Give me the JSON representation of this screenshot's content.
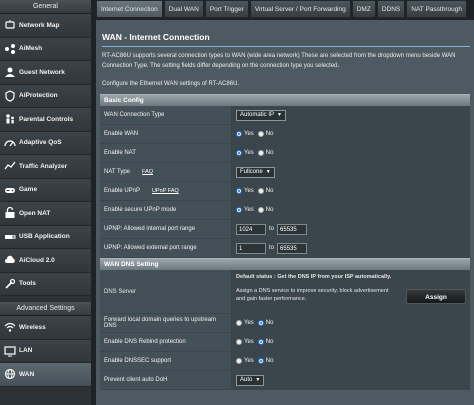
{
  "sidebar": {
    "general_title": "General",
    "items": [
      {
        "label": "Network Map",
        "icon": "network-map-icon"
      },
      {
        "label": "AiMesh",
        "icon": "aimesh-icon"
      },
      {
        "label": "Guest Network",
        "icon": "guest-network-icon"
      },
      {
        "label": "AiProtection",
        "icon": "shield-icon"
      },
      {
        "label": "Parental Controls",
        "icon": "parental-controls-icon"
      },
      {
        "label": "Adaptive QoS",
        "icon": "qos-icon"
      },
      {
        "label": "Traffic Analyzer",
        "icon": "traffic-analyzer-icon"
      },
      {
        "label": "Game",
        "icon": "gamepad-icon"
      },
      {
        "label": "Open NAT",
        "icon": "open-nat-icon"
      },
      {
        "label": "USB Application",
        "icon": "usb-icon"
      },
      {
        "label": "AiCloud 2.0",
        "icon": "cloud-icon"
      },
      {
        "label": "Tools",
        "icon": "tools-icon"
      }
    ],
    "advanced_title": "Advanced Settings",
    "advanced_items": [
      {
        "label": "Wireless",
        "icon": "wireless-icon"
      },
      {
        "label": "LAN",
        "icon": "lan-icon"
      },
      {
        "label": "WAN",
        "icon": "globe-icon"
      }
    ]
  },
  "tabs": [
    "Internet Connection",
    "Dual WAN",
    "Port Trigger",
    "Virtual Server / Port Forwarding",
    "DMZ",
    "DDNS",
    "NAT Passthrough"
  ],
  "page": {
    "title": "WAN - Internet Connection",
    "description": "RT-AC86U supports several connection types to WAN (wide area network) These are selected from the dropdown menu beside WAN Connection Type. The setting fields differ depending on the connection type you selected.",
    "configure": "Configure the Ethernet WAN settings of RT-AC86U."
  },
  "basic": {
    "title": "Basic Config",
    "conn_type_label": "WAN Connection Type",
    "conn_type_value": "Automatic IP",
    "enable_wan_label": "Enable WAN",
    "enable_nat_label": "Enable NAT",
    "nat_type_label": "NAT Type",
    "nat_type_faq": "FAQ",
    "nat_type_value": "Fullcone",
    "upnp_label": "Enable UPnP",
    "upnp_faq": "UPnP FAQ",
    "secure_upnp_label": "Enable secure UPnP mode",
    "internal_range_label": "UPNP: Allowed internal port range",
    "internal_from": "1024",
    "internal_to": "65535",
    "external_range_label": "UPNP: Allowed external port range",
    "external_from": "1",
    "external_to": "65535",
    "to_word": "to",
    "yes": "Yes",
    "no": "No"
  },
  "dns": {
    "title": "WAN DNS Setting",
    "server_label": "DNS Server",
    "status": "Default status : Get the DNS IP from your ISP automatically.",
    "assign_desc": "Assign a DNS service to improve security, block advertisement and gain faster performance.",
    "assign_button": "Assign",
    "forward_label": "Forward local domain queries to upstream DNS",
    "rebind_label": "Enable DNS Rebind protection",
    "dnssec_label": "Enable DNSSEC support",
    "doh_label": "Prevent client auto DoH",
    "doh_value": "Auto"
  },
  "colors": {
    "accent": "#1e6fd9",
    "section": "#7f8a90"
  }
}
